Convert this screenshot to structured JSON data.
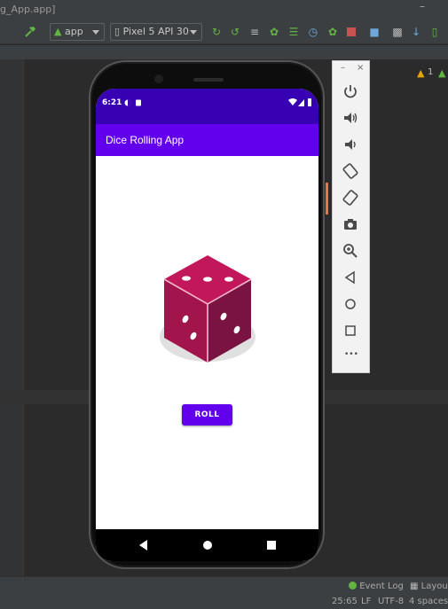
{
  "ide": {
    "title": "g_App.app]",
    "window_minimize": "–",
    "run_config": "app",
    "device": "Pixel 5 API 30",
    "warnings_count": "1"
  },
  "emulator": {
    "status_time": "6:21",
    "app_title": "Dice Rolling App",
    "roll_label": "ROLL",
    "dice_value": 5,
    "panel_minimize": "–",
    "panel_close": "×",
    "more_label": "•••"
  },
  "statusbar": {
    "event_log": "Event Log",
    "layout": "Layout",
    "position": "25:65",
    "line_sep": "LF",
    "encoding": "UTF-8",
    "indent": "4 spaces"
  },
  "colors": {
    "ide_bg": "#2b2b2b",
    "status_bar": "#3700b3",
    "app_bar": "#6200ee",
    "dice_red": "#c2185b"
  }
}
